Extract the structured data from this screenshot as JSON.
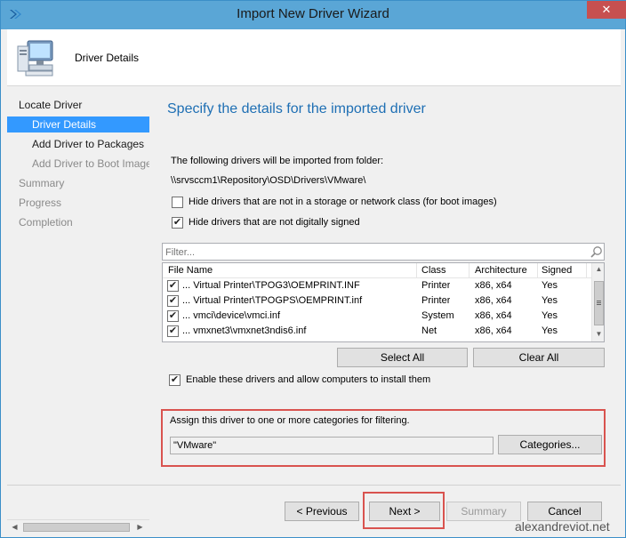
{
  "window": {
    "title": "Import New Driver Wizard",
    "close_label": "✕"
  },
  "header": {
    "title": "Driver Details"
  },
  "nav": {
    "items": [
      {
        "label": "Locate Driver",
        "level": "top",
        "state": "normal"
      },
      {
        "label": "Driver Details",
        "level": "sub",
        "state": "selected"
      },
      {
        "label": "Add Driver to Packages",
        "level": "sub",
        "state": "normal"
      },
      {
        "label": "Add Driver to Boot Images",
        "level": "sub",
        "state": "disabled"
      },
      {
        "label": "Summary",
        "level": "top",
        "state": "disabled"
      },
      {
        "label": "Progress",
        "level": "top",
        "state": "disabled"
      },
      {
        "label": "Completion",
        "level": "top",
        "state": "disabled"
      }
    ]
  },
  "main": {
    "title": "Specify the details for the imported driver",
    "import_label": "The following drivers will be imported from folder:",
    "folder_path": "\\\\srvsccm1\\Repository\\OSD\\Drivers\\VMware\\",
    "hide_storage_label": "Hide drivers that are not in a storage or network class (for boot images)",
    "hide_storage_checked": false,
    "hide_unsigned_label": "Hide drivers that are not digitally signed",
    "hide_unsigned_checked": true,
    "filter_placeholder": "Filter...",
    "columns": [
      "File Name",
      "Class",
      "Architecture",
      "Signed"
    ],
    "rows": [
      {
        "checked": true,
        "file": "... Virtual Printer\\TPOG3\\OEMPRINT.INF",
        "class": "Printer",
        "arch": "x86, x64",
        "signed": "Yes"
      },
      {
        "checked": true,
        "file": "... Virtual Printer\\TPOGPS\\OEMPRINT.inf",
        "class": "Printer",
        "arch": "x86, x64",
        "signed": "Yes"
      },
      {
        "checked": true,
        "file": "... vmci\\device\\vmci.inf",
        "class": "System",
        "arch": "x86, x64",
        "signed": "Yes"
      },
      {
        "checked": true,
        "file": "... vmxnet3\\vmxnet3ndis6.inf",
        "class": "Net",
        "arch": "x86, x64",
        "signed": "Yes"
      }
    ],
    "select_all_label": "Select All",
    "clear_all_label": "Clear All",
    "enable_label": "Enable these drivers and allow computers to install them",
    "enable_checked": true,
    "category_label": "Assign this driver to one or more categories for filtering.",
    "category_value": "\"VMware\"",
    "categories_button": "Categories..."
  },
  "footer": {
    "previous_label": "< Previous",
    "next_label": "Next >",
    "summary_label": "Summary",
    "cancel_label": "Cancel"
  },
  "watermark": "alexandreviot.net",
  "colors": {
    "accent": "#1e6fb4",
    "selection": "#3399ff",
    "highlight_box": "#d9534f",
    "titlebar": "#5aa6d6"
  }
}
